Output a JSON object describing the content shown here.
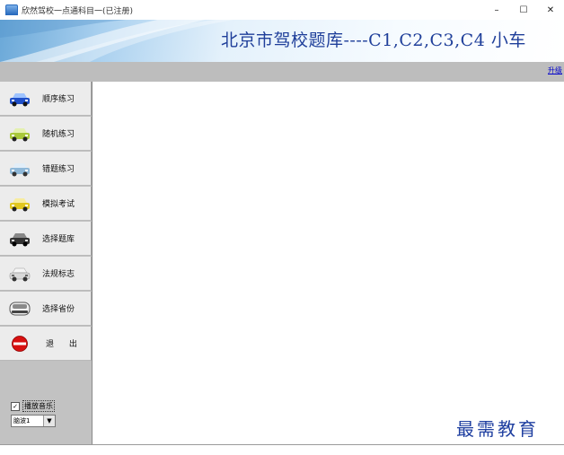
{
  "window": {
    "title": "欣然驾校一点通科目一(已注册)",
    "controls": {
      "minimize": "–",
      "maximize": "☐",
      "close": "✕"
    }
  },
  "banner": {
    "title": "北京市驾校题库----C1,C2,C3,C4 小车"
  },
  "toolbar": {
    "link": "升级"
  },
  "sidebar": {
    "items": [
      {
        "label": "顺序练习",
        "icon": "car-blue-icon",
        "color": "#1f4fc8"
      },
      {
        "label": "随机练习",
        "icon": "car-green-icon",
        "color": "#a8c83a"
      },
      {
        "label": "错题练习",
        "icon": "car-lightblue-icon",
        "color": "#8fb8d8"
      },
      {
        "label": "模拟考试",
        "icon": "car-yellow-icon",
        "color": "#e1c71f"
      },
      {
        "label": "选择题库",
        "icon": "car-black-icon",
        "color": "#333333"
      },
      {
        "label": "法规标志",
        "icon": "car-white-icon",
        "color": "#d9d9d9"
      },
      {
        "label": "选择省份",
        "icon": "car-front-icon",
        "color": "#8a8a8a"
      },
      {
        "label": "退 出",
        "icon": "no-entry-icon",
        "color": "#d81010"
      }
    ],
    "music": {
      "checked": true,
      "checkmark": "✓",
      "label": "播放音乐"
    },
    "music_select": {
      "value": "脑波1",
      "arrow": "▼"
    }
  },
  "watermark": {
    "text": "最需教育"
  }
}
